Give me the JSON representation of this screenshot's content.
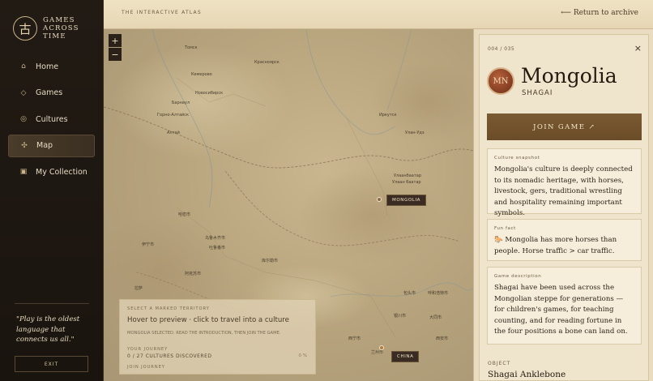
{
  "brand": {
    "line1": "GAMES",
    "line2": "ACROSS",
    "line3": "TIME",
    "mark": "古"
  },
  "nav": [
    {
      "label": "Home",
      "icon": "⌂"
    },
    {
      "label": "Games",
      "icon": "◇"
    },
    {
      "label": "Cultures",
      "icon": "◎"
    },
    {
      "label": "Map",
      "icon": "✣"
    },
    {
      "label": "My Collection",
      "icon": "▣"
    }
  ],
  "quote": "\"Play is the oldest language that connects us all.\"",
  "exit_label": "EXIT",
  "topbar": {
    "atlas_label": "THE INTERACTIVE ATLAS",
    "return_label": "⟵ Return to archive"
  },
  "map": {
    "zoom_in": "+",
    "zoom_out": "−",
    "tag_mongolia": "MONGOLIA",
    "tag_china": "CHINA",
    "places": {
      "tomsk": "Томск",
      "krasnoyarsk": "Красноярск",
      "kemerovo": "Кемерово",
      "novosibirsk": "Новосибирск",
      "barnaul": "Барнаул",
      "gorno": "Горно-Алтайск",
      "altai": "Алтай",
      "irkutsk": "Иркутск",
      "ulanude": "Улан-Удэ",
      "ulaanbaatar": "Улаанбаатар",
      "ulaanbaatar2": "Улаан баатар",
      "hami": "哈密市",
      "urumqi": "乌鲁木齐市",
      "turpan": "吐鲁番市",
      "korla": "库尔勒市",
      "yining": "伊宁市",
      "aksu": "阿克苏市",
      "baotou": "包头市",
      "yinchuan": "银川市",
      "xining": "西宁市",
      "lanzhou": "兰州市",
      "lhasa": "拉萨",
      "hohhot": "呼和浩特市",
      "xian": "西安市",
      "datong": "大同市"
    },
    "info": {
      "select_label": "SELECT A MARKED TERRITORY",
      "hint": "Hover to preview · click to travel into a culture",
      "selected": "MONGOLIA SELECTED. READ THE INTRODUCTION, THEN JOIN THE GAME.",
      "journey_label": "YOUR JOURNEY",
      "progress": "0 / 27 CULTURES DISCOVERED",
      "percent": "0 %",
      "journal_label": "JOIN JOURNEY"
    }
  },
  "panel": {
    "counter": "004 / 035",
    "close": "×",
    "badge": "MN",
    "country": "Mongolia",
    "game": "SHAGAI",
    "join_label": "JOIN GAME ↗",
    "snapshot_label": "Culture snapshot",
    "snapshot_text": "Mongolia's culture is deeply connected to its nomadic heritage, with horses, livestock, gers, traditional wrestling and hospitality remaining important symbols.",
    "fun_label": "Fun fact",
    "fun_text": "🐎 Mongolia has more horses than people. Horse traffic > car traffic.",
    "desc_label": "Game description",
    "desc_text": "Shagai have been used across the Mongolian steppe for generations — for children's games, for teaching counting, and for reading fortune in the four positions a bone can land on.",
    "object_label": "OBJECT",
    "object_name": "Shagai Anklebone"
  }
}
